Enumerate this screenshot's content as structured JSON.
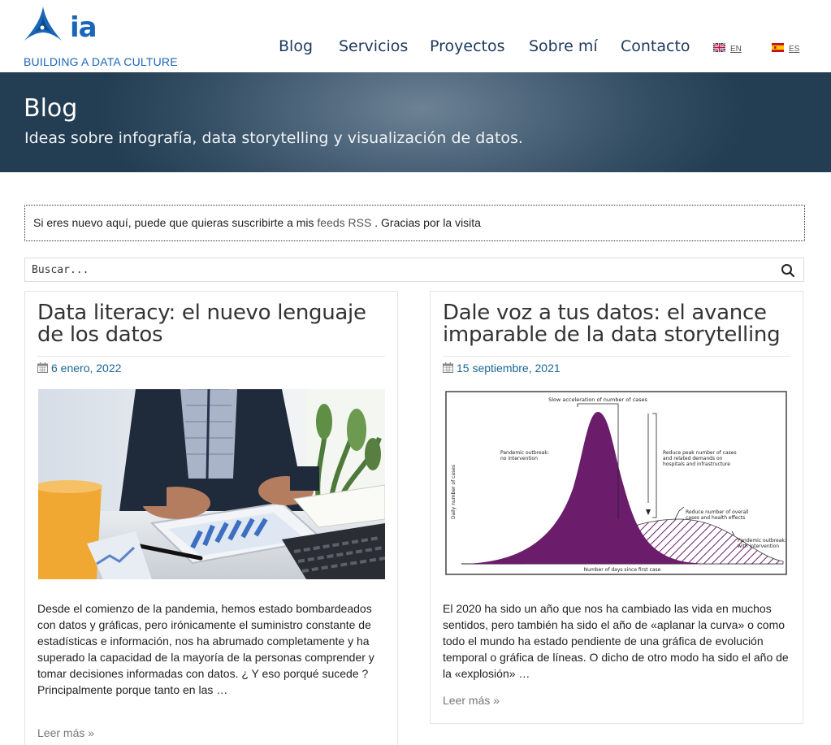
{
  "brand": {
    "logo_text": "ia",
    "tagline": "BUILDING A DATA CULTURE",
    "color": "#1a66b8"
  },
  "nav": {
    "items": [
      "Blog",
      "Servicios",
      "Proyectos",
      "Sobre mí",
      "Contacto"
    ],
    "languages": [
      {
        "code": "EN",
        "flag": "uk-flag-icon"
      },
      {
        "code": "ES",
        "flag": "spain-flag-icon"
      }
    ]
  },
  "hero": {
    "title": "Blog",
    "subtitle": "Ideas sobre infografía, data storytelling y visualización de datos."
  },
  "notice": {
    "prefix": "Si eres nuevo aquí, puede que quieras suscribirte a mis ",
    "link": "feeds RSS",
    "suffix": " . Gracias por la visita"
  },
  "search": {
    "placeholder": "Buscar...",
    "icon": "search-icon"
  },
  "posts": [
    {
      "title": "Data literacy: el nuevo lenguaje de los datos",
      "date": "6 enero, 2022",
      "excerpt": "Desde el comienzo de la pandemia, hemos estado bombardeados con datos y gráficas, pero irónicamente el suministro constante de estadísticas e información, nos ha abrumado completamente y ha superado la capacidad de la mayoría de la personas comprender y tomar decisiones informadas con datos. ¿ Y eso porqué sucede ? Principalmente porque tanto en las …",
      "more": "Leer más »"
    },
    {
      "title": "Dale voz a tus datos: el avance imparable de la data storytelling",
      "date": "15 septiembre, 2021",
      "excerpt": "El 2020 ha sido un año que nos ha cambiado las vida en muchos sentidos, pero también ha sido el año de «aplanar la curva» o como todo el mundo ha estado pendiente de una gráfica de evolución temporal o gráfica de líneas. O dicho de otro modo ha sido el año de la «explosión» …",
      "more": "Leer más »",
      "figure": {
        "top_label": "Slow acceleration of number of cases",
        "peak_label": "Pandemic outbreak: no intervention",
        "reduce_peak": "Reduce peak number of cases and related demands on hospitals and infrastructure",
        "reduce_overall": "Reduce number of overall cases and health effects",
        "with_label": "Pandemic outbreak: with intervention",
        "ylabel": "Daily number of cases",
        "xlabel": "Number of days since first case",
        "colors": {
          "no_intervention": "#6b1d6b",
          "with_intervention": "#6b1d6b"
        }
      }
    }
  ]
}
